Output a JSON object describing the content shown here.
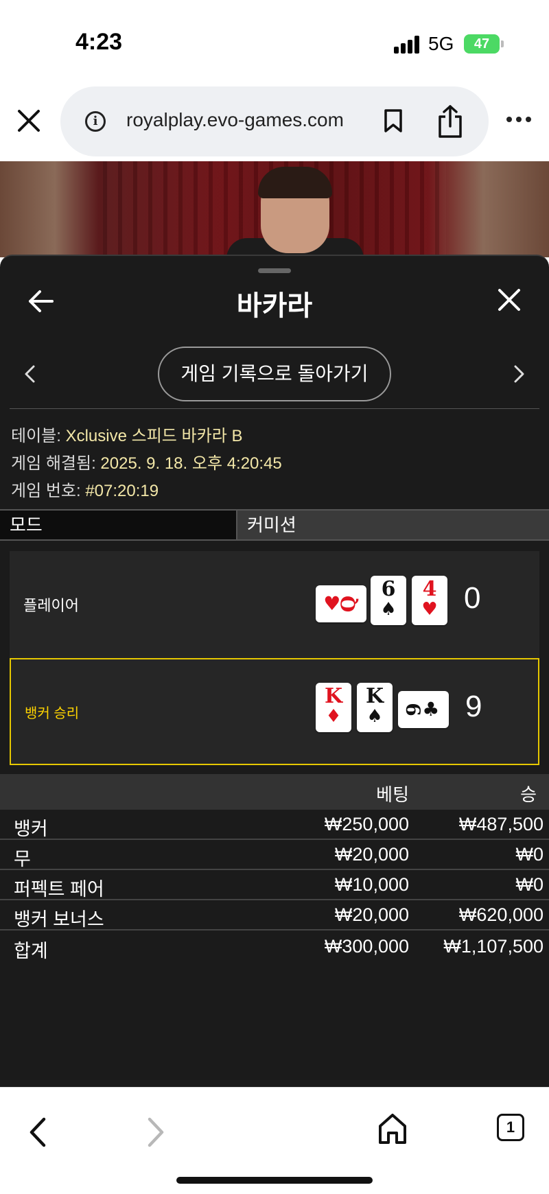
{
  "status_bar": {
    "time": "4:23",
    "network": "5G",
    "battery": "47"
  },
  "browser": {
    "url": "royalplay.evo-games.com",
    "tabs_count": "1"
  },
  "panel": {
    "title": "바카라",
    "history_button": "게임 기록으로 돌아가기",
    "info": {
      "table_label": "테이블:",
      "table_value": "Xclusive 스피드 바카라 B",
      "resolved_label": "게임 해결됨:",
      "resolved_value": "2025. 9. 18. 오후 4:20:45",
      "game_no_label": "게임 번호:",
      "game_no_value": "#07:20:19"
    },
    "mode_label": "모드",
    "mode_value": "커미션",
    "player": {
      "label": "플레이어",
      "score": "0",
      "cards": [
        {
          "rank": "Q",
          "suit": "♥",
          "color": "red",
          "orientation": "sideways"
        },
        {
          "rank": "6",
          "suit": "♠",
          "color": "black",
          "orientation": "upright"
        },
        {
          "rank": "4",
          "suit": "♥",
          "color": "red",
          "orientation": "upright"
        }
      ]
    },
    "banker": {
      "label": "뱅커 승리",
      "score": "9",
      "cards": [
        {
          "rank": "K",
          "suit": "♦",
          "color": "red",
          "orientation": "upright"
        },
        {
          "rank": "K",
          "suit": "♠",
          "color": "black",
          "orientation": "upright"
        },
        {
          "rank": "9",
          "suit": "♣",
          "color": "black",
          "orientation": "sideways"
        }
      ]
    },
    "bets": {
      "header_bet": "베팅",
      "header_win": "승",
      "rows": [
        {
          "name": "뱅커",
          "bet": "₩250,000",
          "win": "₩487,500"
        },
        {
          "name": "무",
          "bet": "₩20,000",
          "win": "₩0"
        },
        {
          "name": "퍼펙트 페어",
          "bet": "₩10,000",
          "win": "₩0"
        },
        {
          "name": "뱅커 보너스",
          "bet": "₩20,000",
          "win": "₩620,000"
        }
      ],
      "total": {
        "name": "합계",
        "bet": "₩300,000",
        "win": "₩1,107,500"
      }
    }
  },
  "colors": {
    "panel_bg": "#1b1b1b",
    "winner_border": "#e6c800",
    "winner_text": "#ffd400",
    "info_value": "#f3e7a8",
    "battery": "#4cd964",
    "card_red": "#e0131f"
  }
}
